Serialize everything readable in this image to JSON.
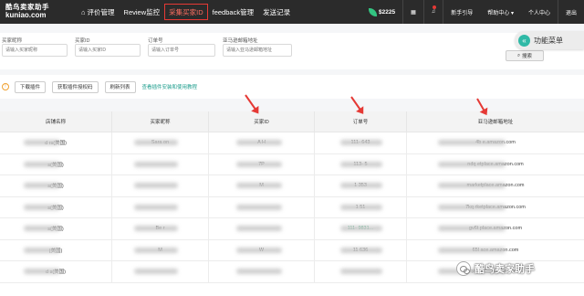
{
  "app": {
    "logo_cn": "酷鸟卖家助手",
    "logo_en": "kuniao.com"
  },
  "nav": {
    "items": [
      {
        "icon": "home-icon",
        "label": "评价管理"
      },
      {
        "label": "Review监控"
      },
      {
        "label": "采集买家ID",
        "active": true
      },
      {
        "label": "feedback管理"
      },
      {
        "label": "发送记录"
      }
    ],
    "balance": "$2225",
    "guide": "新手引导",
    "help": "帮助中心 ▾",
    "user_center": "个人中心",
    "logout": "退出"
  },
  "filters": {
    "fields": [
      {
        "label": "买家昵称",
        "placeholder": "请输入买家昵称"
      },
      {
        "label": "买家ID",
        "placeholder": "请输入买家ID"
      },
      {
        "label": "订单号",
        "placeholder": "请输入订单号"
      },
      {
        "label": "亚马逊邮箱地址",
        "placeholder": "请输入亚马逊邮箱地址"
      }
    ],
    "search_label": "搜索"
  },
  "func_menu": {
    "label": "功能菜单",
    "icon": "double-chevron-left-icon"
  },
  "actions": {
    "download_plugin": "下载插件",
    "get_auth": "获取插件授权码",
    "refresh_list": "刷新列表",
    "help_link": "查看插件安装和使用教程"
  },
  "table": {
    "headers": [
      "店铺名称",
      "买家昵称",
      "买家ID",
      "订单号",
      "亚马逊邮箱地址"
    ],
    "rows": [
      [
        "d  rs(美国)",
        "Sara  on",
        "A  H",
        "111-  643",
        "4b  e.amazon.com"
      ],
      [
        "  s(美国)",
        "",
        "  7P",
        "113-  5",
        "ndq  etplace.amazon.com"
      ],
      [
        "  s(美国)",
        "",
        "  M",
        "1  353",
        "  marketplace.amazon.com"
      ],
      [
        "  s(美国)",
        "",
        "  ",
        "1  51",
        "7kq  rketplace.amazon.com"
      ],
      [
        "  s(美国)",
        "Be  r",
        "  ",
        "111-  9831...",
        "gv6t  place.amazon.com"
      ],
      [
        "  (美国)",
        "M",
        "  W",
        "11  636",
        "65l  ace.amazon.com"
      ],
      [
        "d  s(美国)",
        "",
        "  ",
        "",
        "qzws  ace.amazon.com"
      ]
    ]
  },
  "watermark": "酷鸟卖家助手",
  "colors": {
    "accent": "#e53935",
    "teal": "#2fb9a6",
    "link": "#1a9c8c"
  }
}
